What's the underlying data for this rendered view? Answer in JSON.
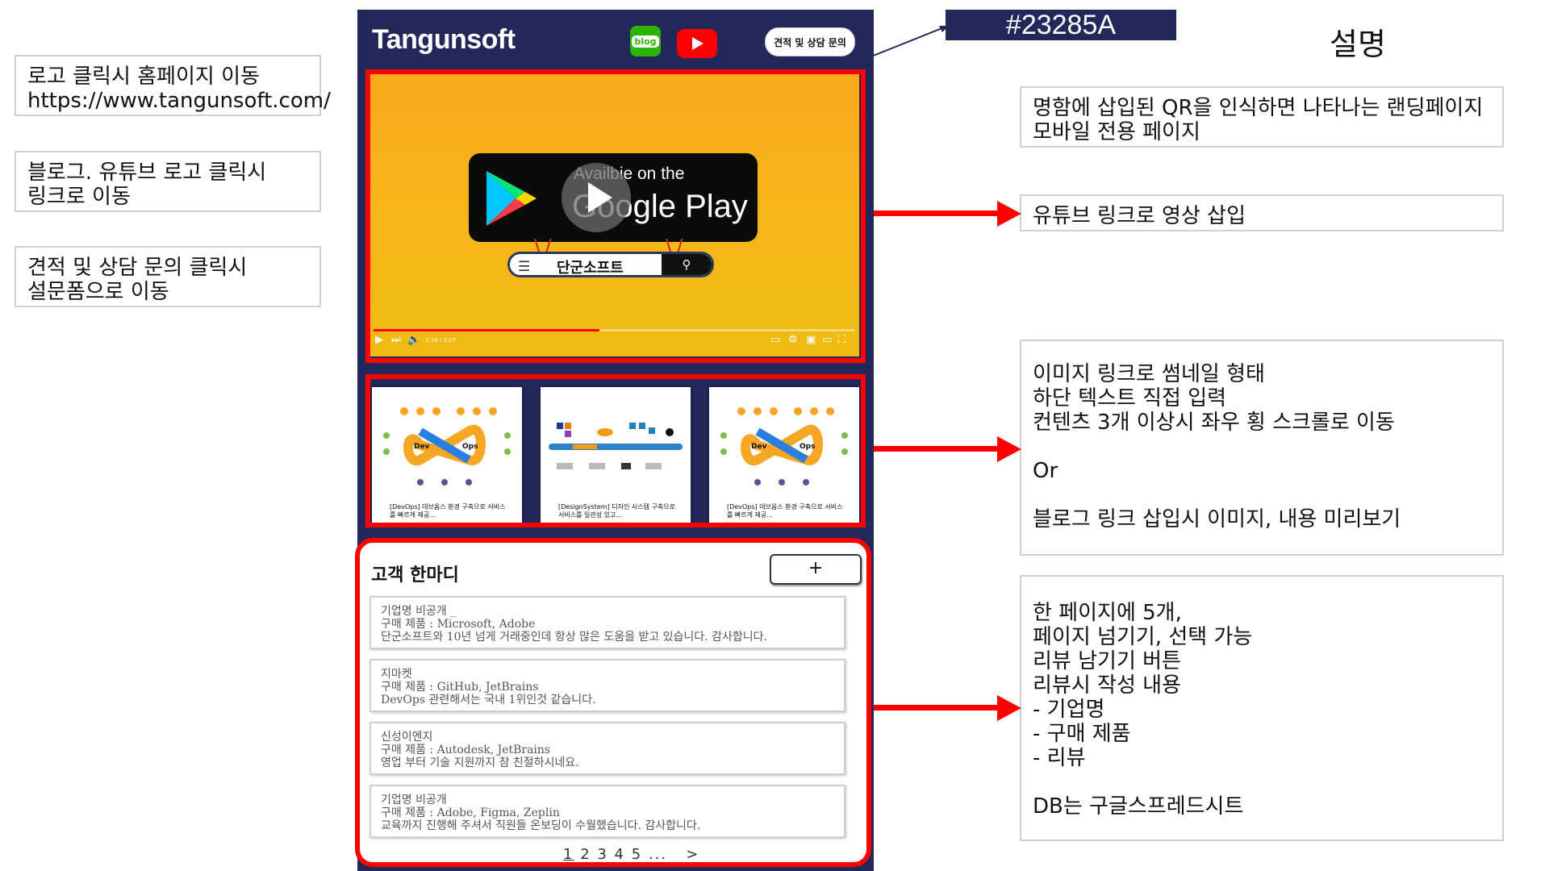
{
  "left_notes": [
    "로고 클릭시 홈페이지 이동\nhttps://www.tangunsoft.com/",
    "블로그. 유튜브 로고 클릭시\n링크로 이동",
    "견적 및 상담 문의 클릭시\n설문폼으로 이동"
  ],
  "right_notes": {
    "landing": "명함에 삽입된 QR을 인식하면 나타나는 랜딩페이지\n모바일 전용 페이지",
    "youtube": "유튜브 링크로 영상 삽입",
    "thumbnails": "이미지 링크로 썸네일 형태\n하단 텍스트 직접 입력\n컨텐츠 3개 이상시 좌우 횡 스크롤로 이동\n\nOr\n\n블로그 링크 삽입시 이미지, 내용 미리보기",
    "reviews": "한 페이지에 5개,\n페이지 넘기기, 선택 가능\n리뷰 남기기 버튼\n리뷰시 작성 내용\n-  기업명\n-  구매 제품\n-  리뷰\n\nDB는 구글스프레드시트"
  },
  "color_tag": "#23285A",
  "description_title": "설명",
  "header": {
    "brand": "Tangunsoft",
    "blog_icon_text": "blog",
    "inquiry_button": "견적 및 상담 문의"
  },
  "video": {
    "badge_small": "Availbie on the",
    "badge_big": "Google Play",
    "search_term": "단군소프트",
    "time": "1:10 / 2:07",
    "progress": 0.47
  },
  "thumbnails": [
    {
      "caption": "[DevOps] 데브옵스 환경 구축으로 서비스를 빠르게 제공...",
      "art": "devops"
    },
    {
      "caption": "[DesignSystem] 디자인 시스템 구축으로 서비스를 일관성 있고...",
      "art": "design"
    },
    {
      "caption": "[DevOps] 데브옵스 환경 구축으로 서비스를 빠르게 제공...",
      "art": "devops"
    }
  ],
  "reviews_panel": {
    "title": "고객 한마디",
    "add_button": "+",
    "items": [
      {
        "company": "기업명 비공개 _",
        "product": "구매 제품 : Microsoft, Adobe",
        "text": "단군소프트와 10년 넘게 거래중인데 항상 많은 도움을 받고 있습니다. 감사합니다."
      },
      {
        "company": "지마켓",
        "product": "구매 제품 : GitHub, JetBrains",
        "text": "DevOps 관련해서는 국내 1위인것 같습니다."
      },
      {
        "company": "신성이엔지",
        "product": "구매 제품 : Autodesk, JetBrains",
        "text": "영업 부터 기술 지원까지 참 친절하시네요."
      },
      {
        "company": "기업명 비공개",
        "product": "구매 제품 : Adobe, Figma, Zeplin",
        "text": "교육까지 진행해 주셔서 직원들 온보딩이 수월했습니다. 감사합니다."
      }
    ],
    "pager": {
      "current": "1",
      "pages": "2 3 4 5 ...",
      "next": ">"
    }
  }
}
